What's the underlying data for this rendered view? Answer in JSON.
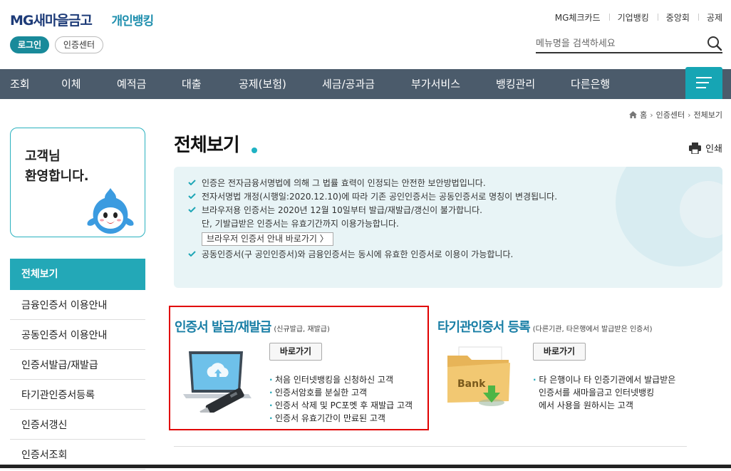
{
  "header": {
    "brand": "MG새마을금고",
    "brand_sub": "개인뱅킹",
    "login_label": "로그인",
    "cert_center_label": "인증센터",
    "top_links": [
      "MG체크카드",
      "기업뱅킹",
      "중앙회",
      "공제"
    ],
    "search_placeholder": "메뉴명을 검색하세요"
  },
  "nav": {
    "items": [
      "조회",
      "이체",
      "예적금",
      "대출",
      "공제(보험)",
      "세금/공과금",
      "부가서비스",
      "뱅킹관리",
      "다른은행"
    ]
  },
  "breadcrumb": [
    "홈",
    "인증센터",
    "전체보기"
  ],
  "sidebar": {
    "welcome": "고객님\n환영합니다.",
    "items": [
      "전체보기",
      "금융인증서 이용안내",
      "공동인증서 이용안내",
      "인증서발급/재발급",
      "타기관인증서등록",
      "인증서갱신",
      "인증서조회"
    ]
  },
  "main": {
    "title": "전체보기",
    "print_label": "인쇄",
    "notice": {
      "items": [
        "인증은 전자금융서명법에 의해 그 법률 효력이 인정되는 안전한 보안방법입니다.",
        "전자서명법 개정(시행일:2020.12.10)에 따라 기존 공인인증서는 공동인증서로 명칭이 변경됩니다.",
        "브라우저용 인증서는 2020년 12월 10일부터 발급/재발급/갱신이 불가합니다."
      ],
      "sub_line": "단, 기발급받은 인증서는 유효기간까지 이용가능합니다.",
      "browser_link": "브라우저 인증서 안내 바로가기 〉",
      "last_item": "공동인증서(구 공인인증서)와 금융인증서는 동시에 유효한 인증서로 이용이 가능합니다."
    },
    "card1": {
      "title": "인증서 발급/재발급",
      "subtitle": "(신규발급, 재발급)",
      "button": "바로가기",
      "bullets": [
        "처음 인터넷뱅킹을 신청하신 고객",
        "인증서암호를 분실한 고객",
        "인증서 삭제 및 PC포멧 후 재발급 고객",
        "인증서 유효기간이 만료된 고객"
      ]
    },
    "card2": {
      "title": "타기관인증서 등록",
      "subtitle": "(다른기관, 타은행에서 발급받은 인증서)",
      "button": "바로가기",
      "lines": [
        "타 은행이나 타 인증기관에서 발급받은",
        "인증서를 새마을금고 인터넷뱅킹",
        "에서 사용을 원하시는 고객"
      ],
      "folder_label": "Bank"
    }
  },
  "colors": {
    "accent": "#23a8b7",
    "nav_bg": "#4b5b6b",
    "brand": "#1d3b78",
    "card_title": "#1a7fa6",
    "highlight_border": "#e10000"
  }
}
